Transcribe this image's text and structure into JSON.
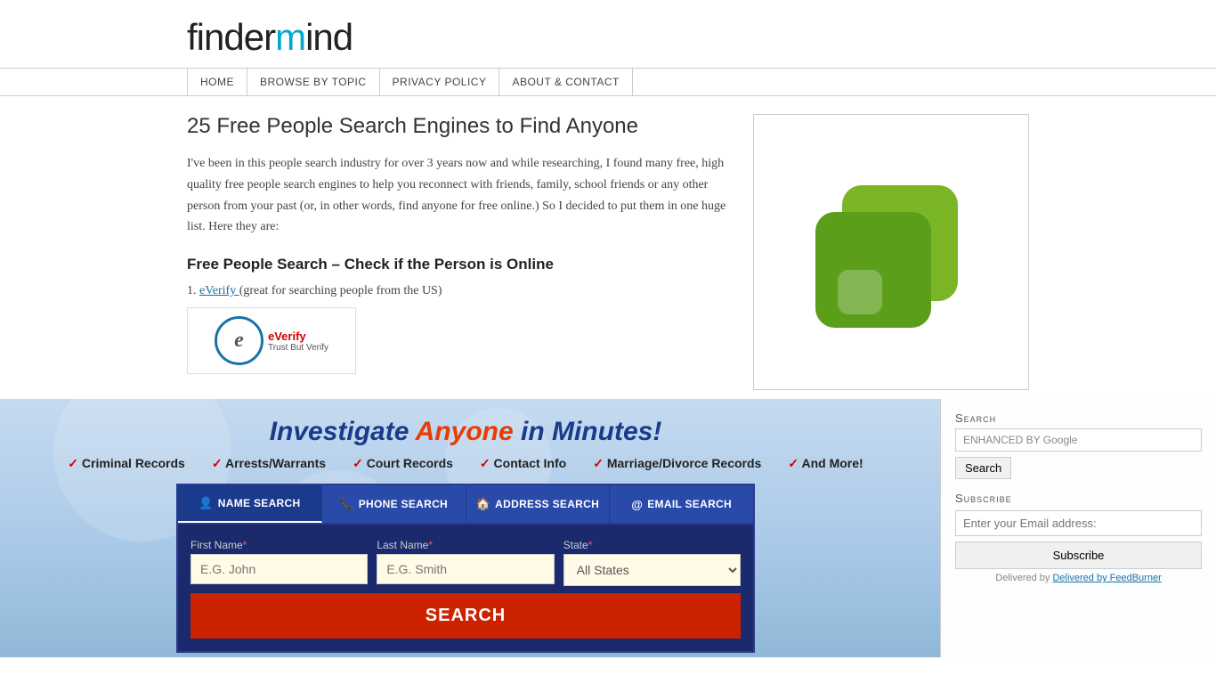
{
  "header": {
    "logo_text_before_m": "finder",
    "logo_m": "m",
    "logo_text_after_m": "ind"
  },
  "nav": {
    "items": [
      {
        "label": "HOME",
        "href": "#"
      },
      {
        "label": "BROWSE BY TOPIC",
        "href": "#"
      },
      {
        "label": "PRIVACY POLICY",
        "href": "#"
      },
      {
        "label": "ABOUT & CONTACT",
        "href": "#"
      }
    ]
  },
  "article": {
    "title": "25 Free People Search Engines to Find Anyone",
    "body": "I've been in this people search industry for over 3 years now and while researching, I found many free, high quality free people search engines to help you reconnect with friends, family, school friends or any other person from your past (or, in other words, find anyone for free online.) So I decided to put them in one huge list. Here they are:",
    "section_title": "Free People Search – Check if the Person is Online",
    "list_item": "1. eVerify (great for searching people from the US)"
  },
  "sidebar": {
    "box_alt": "Green logo image"
  },
  "banner": {
    "title_before": "Investigate ",
    "title_anyone": "Anyone",
    "title_after": " in Minutes!",
    "checks": [
      "Criminal Records",
      "Arrests/Warrants",
      "Court Records",
      "Contact Info",
      "Marriage/Divorce Records",
      "And More!"
    ]
  },
  "search_widget": {
    "search_title": "Search",
    "google_label": "ENHANCED BY Google",
    "search_btn_label": "Search",
    "subscribe_title": "Subscribe",
    "email_placeholder": "Enter your Email address:",
    "subscribe_btn_label": "Subscribe",
    "feedburner_text": "Delivered by FeedBurner"
  },
  "people_search": {
    "tabs": [
      {
        "label": "NAME SEARCH",
        "icon": "👤",
        "active": true
      },
      {
        "label": "PHONE SEARCH",
        "icon": "📞",
        "active": false
      },
      {
        "label": "ADDRESS SEARCH",
        "icon": "🏠",
        "active": false
      },
      {
        "label": "EMAIL SEARCH",
        "icon": "@",
        "active": false
      }
    ],
    "first_name_label": "First Name",
    "first_name_placeholder": "E.G. John",
    "last_name_label": "Last Name",
    "last_name_placeholder": "E.G. Smith",
    "state_label": "State",
    "state_default": "All States",
    "search_btn_label": "SEARCH"
  }
}
